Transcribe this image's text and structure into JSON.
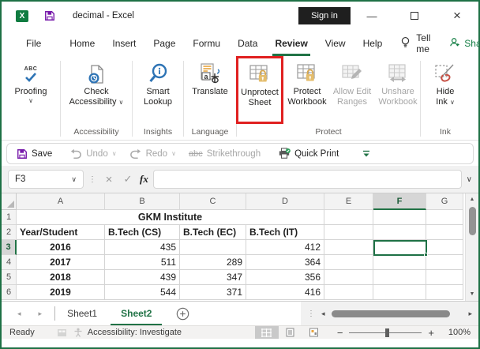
{
  "window": {
    "title": "decimal - Excel",
    "sign_in": "Sign in"
  },
  "menu": {
    "items": [
      "File",
      "Home",
      "Insert",
      "Page",
      "Formu",
      "Data",
      "Review",
      "View",
      "Help"
    ],
    "active": "Review",
    "tell_me": "Tell me",
    "share": "Share"
  },
  "ribbon": {
    "proofing": {
      "label": "Proofing"
    },
    "check_accessibility": {
      "line1": "Check",
      "line2": "Accessibility"
    },
    "smart_lookup": {
      "line1": "Smart",
      "line2": "Lookup"
    },
    "translate": {
      "label": "Translate"
    },
    "unprotect_sheet": {
      "line1": "Unprotect",
      "line2": "Sheet"
    },
    "protect_workbook": {
      "line1": "Protect",
      "line2": "Workbook"
    },
    "allow_edit_ranges": {
      "line1": "Allow Edit",
      "line2": "Ranges"
    },
    "unshare_workbook": {
      "line1": "Unshare",
      "line2": "Workbook"
    },
    "hide_ink": {
      "line1": "Hide",
      "line2": "Ink"
    },
    "groups": {
      "accessibility": "Accessibility",
      "insights": "Insights",
      "language": "Language",
      "protect": "Protect",
      "ink": "Ink"
    }
  },
  "qat": {
    "save": "Save",
    "undo": "Undo",
    "redo": "Redo",
    "strikethrough_abc": "abc",
    "strikethrough": "Strikethrough",
    "quick_print": "Quick Print"
  },
  "formula_bar": {
    "name_box": "F3",
    "fx": "fx",
    "formula": ""
  },
  "grid": {
    "columns": [
      "A",
      "B",
      "C",
      "D",
      "E",
      "F",
      "G"
    ],
    "selected_column": "F",
    "rows": [
      "1",
      "2",
      "3",
      "4",
      "5",
      "6"
    ],
    "selected_row": "3",
    "selected_cell": "F3",
    "title": "GKM Institute",
    "headers": [
      "Year/Student",
      "B.Tech (CS)",
      "B.Tech (EC)",
      "B.Tech (IT)"
    ],
    "data": [
      [
        "2016",
        "435",
        "",
        "412"
      ],
      [
        "2017",
        "511",
        "289",
        "364"
      ],
      [
        "2018",
        "439",
        "347",
        "356"
      ],
      [
        "2019",
        "544",
        "371",
        "416"
      ]
    ]
  },
  "sheet_tabs": {
    "tabs": [
      "Sheet1",
      "Sheet2"
    ],
    "active": "Sheet2"
  },
  "status_bar": {
    "ready": "Ready",
    "accessibility": "Accessibility: Investigate",
    "zoom": "100%"
  },
  "colors": {
    "accent_green": "#217346",
    "highlight_red": "#e02020",
    "save_purple": "#7719aa",
    "icon_blue": "#2e74b5",
    "lock_gold": "#dcaf4a"
  }
}
